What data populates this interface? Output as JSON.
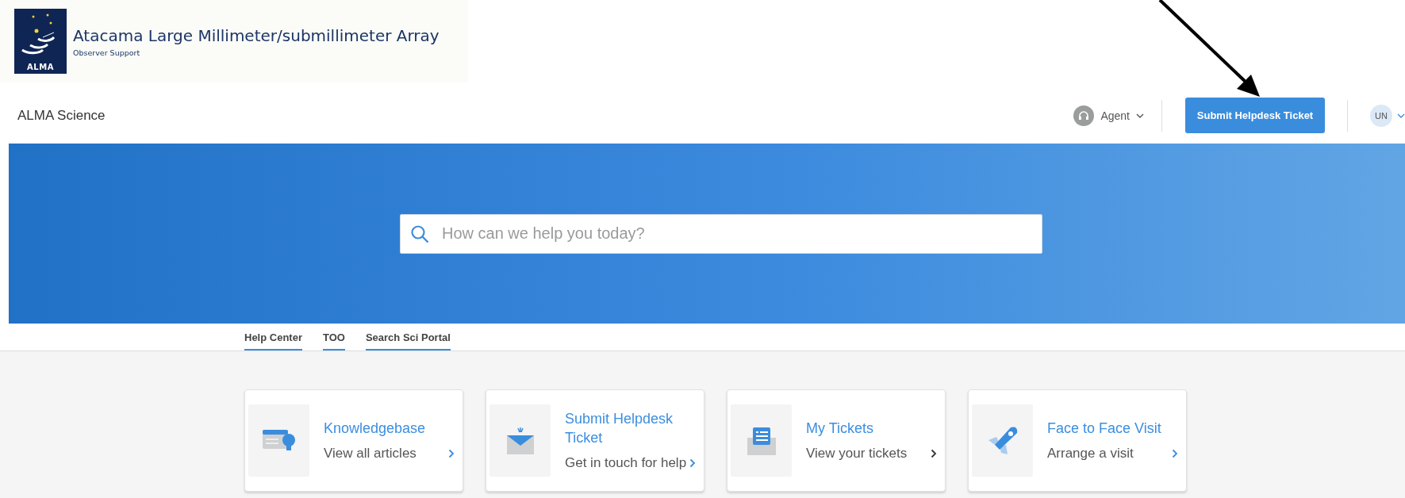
{
  "header": {
    "logo_text": "ALMA",
    "title": "Atacama Large Millimeter/submillimeter Array",
    "subtitle": "Observer Support"
  },
  "nav": {
    "brand": "ALMA Science",
    "role": "Agent",
    "submit_button": "Submit Helpdesk Ticket",
    "avatar": "UN"
  },
  "search": {
    "placeholder": "How can we help you today?"
  },
  "tabs": [
    {
      "label": "Help Center"
    },
    {
      "label": "TOO"
    },
    {
      "label": "Search Sci Portal"
    }
  ],
  "cards": [
    {
      "kind": "knowledgebase",
      "title": "Knowledgebase",
      "description": "View all articles"
    },
    {
      "kind": "submit",
      "title": "Submit Helpdesk Ticket",
      "description": "Get in touch for help"
    },
    {
      "kind": "tickets",
      "title": "My Tickets",
      "description": "View your tickets"
    },
    {
      "kind": "visit",
      "title": "Face to Face Visit",
      "description": "Arrange a visit"
    }
  ]
}
